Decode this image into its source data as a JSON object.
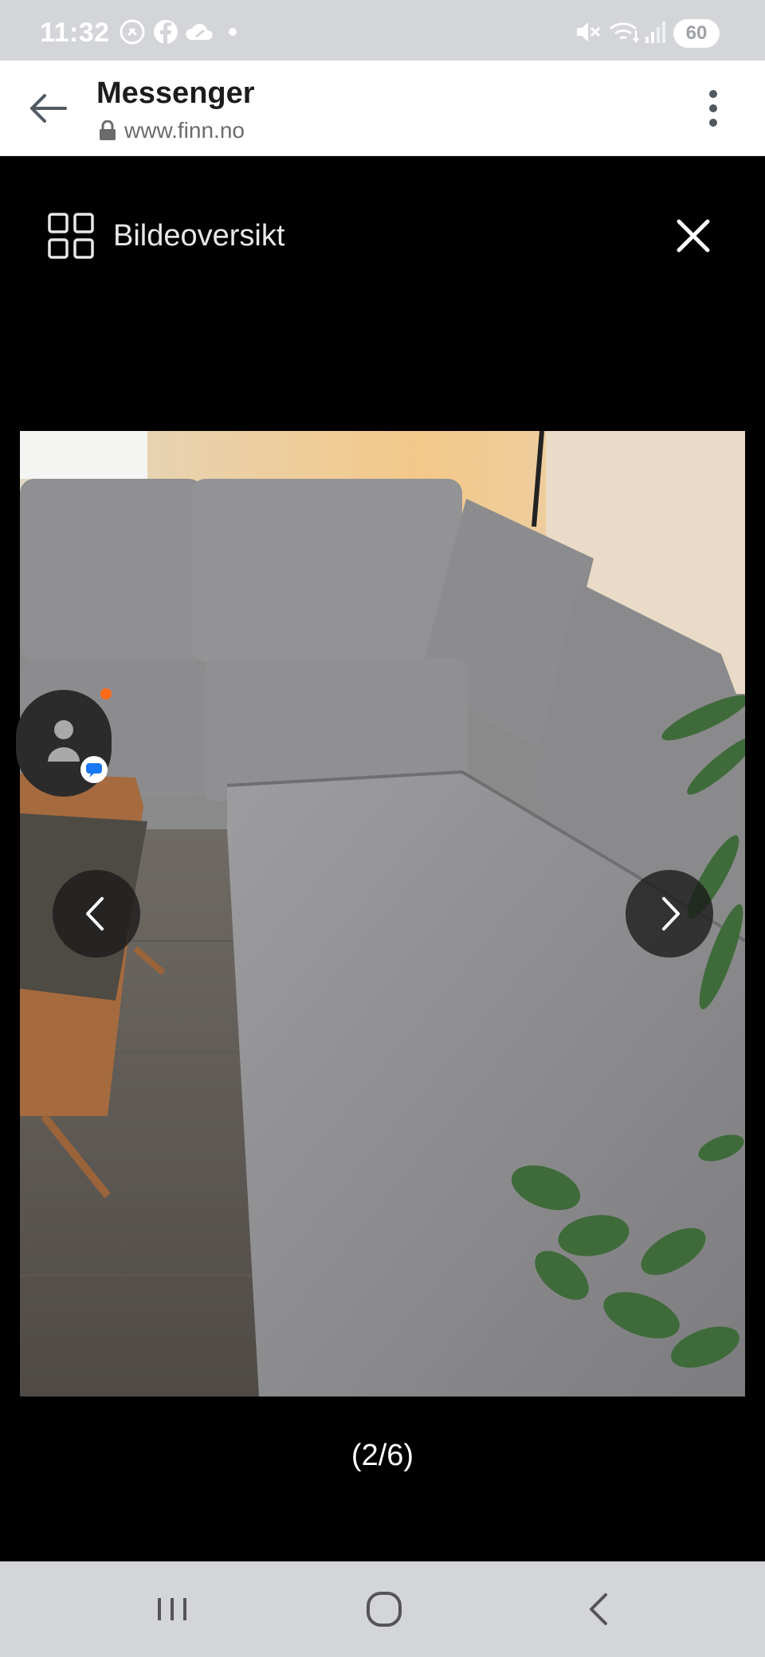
{
  "status_bar": {
    "time": "11:32",
    "battery": "60",
    "icons": [
      "shazam-icon",
      "facebook-icon",
      "cloud-icon",
      "dot-icon",
      "mute-icon",
      "wifi-icon",
      "signal-icon"
    ]
  },
  "header": {
    "title": "Messenger",
    "url": "www.finn.no"
  },
  "viewer": {
    "overview_label": "Bildeoversikt",
    "counter": "(2/6)"
  },
  "colors": {
    "status_bar_bg": "#d3d5d9",
    "viewer_bg": "#000000",
    "chat_dot": "#ff6b1a",
    "chat_badge": "#1877f2"
  }
}
